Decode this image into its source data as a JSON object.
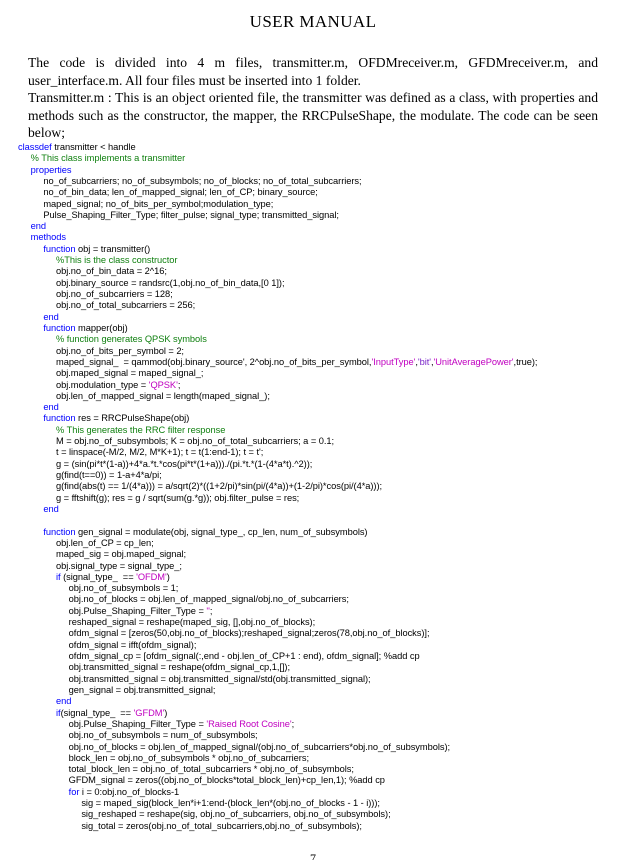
{
  "document": {
    "title": "USER MANUAL",
    "page_number": "7",
    "intro": {
      "paragraph_1": "The code is divided into 4 m files, transmitter.m, OFDMreceiver.m, GFDMreceiver.m, and user_interface.m. All four files must be inserted into 1 folder.",
      "paragraph_2": "Transmitter.m : This is an object oriented file, the transmitter was defined as a class, with properties and methods such as the constructor, the mapper, the RRCPulseShape, the modulate. The code can be seen below;"
    }
  },
  "colors": {
    "keyword": "#0000ff",
    "comment": "#108010",
    "string": "#c000c0",
    "string_alt": "#7a26c9",
    "text": "#000000",
    "background": "#ffffff"
  },
  "code_listing": {
    "language": "MATLAB",
    "lines": [
      {
        "indent": 0,
        "tokens": [
          {
            "t": "classdef ",
            "c": "kw"
          },
          {
            "t": "transmitter < handle",
            "c": "txt"
          }
        ]
      },
      {
        "indent": 1,
        "tokens": [
          {
            "t": "% This class implements a transmitter",
            "c": "cmt"
          }
        ]
      },
      {
        "indent": 1,
        "tokens": [
          {
            "t": "properties",
            "c": "kw"
          }
        ]
      },
      {
        "indent": 2,
        "tokens": [
          {
            "t": "no_of_subcarriers; no_of_subsymbols; no_of_blocks; no_of_total_subcarriers;",
            "c": "txt"
          }
        ]
      },
      {
        "indent": 2,
        "tokens": [
          {
            "t": "no_of_bin_data; len_of_mapped_signal; len_of_CP; binary_source;",
            "c": "txt"
          }
        ]
      },
      {
        "indent": 2,
        "tokens": [
          {
            "t": "maped_signal; no_of_bits_per_symbol;modulation_type;",
            "c": "txt"
          }
        ]
      },
      {
        "indent": 2,
        "tokens": [
          {
            "t": "Pulse_Shaping_Filter_Type; filter_pulse; signal_type; transmitted_signal;",
            "c": "txt"
          }
        ]
      },
      {
        "indent": 1,
        "tokens": [
          {
            "t": "end",
            "c": "kw"
          }
        ]
      },
      {
        "indent": 1,
        "tokens": [
          {
            "t": "methods",
            "c": "kw"
          }
        ]
      },
      {
        "indent": 2,
        "tokens": [
          {
            "t": "function ",
            "c": "kw"
          },
          {
            "t": "obj = transmitter()",
            "c": "txt"
          }
        ]
      },
      {
        "indent": 3,
        "tokens": [
          {
            "t": "%This is the class constructor",
            "c": "cmt"
          }
        ]
      },
      {
        "indent": 3,
        "tokens": [
          {
            "t": "obj.no_of_bin_data = 2^16;",
            "c": "txt"
          }
        ]
      },
      {
        "indent": 3,
        "tokens": [
          {
            "t": "obj.binary_source = randsrc(1,obj.no_of_bin_data,[0 1]);",
            "c": "txt"
          }
        ]
      },
      {
        "indent": 3,
        "tokens": [
          {
            "t": "obj.no_of_subcarriers = 128;",
            "c": "txt"
          }
        ]
      },
      {
        "indent": 3,
        "tokens": [
          {
            "t": "obj.no_of_total_subcarriers = 256;",
            "c": "txt"
          }
        ]
      },
      {
        "indent": 2,
        "tokens": [
          {
            "t": "end",
            "c": "kw"
          }
        ]
      },
      {
        "indent": 2,
        "tokens": [
          {
            "t": "function ",
            "c": "kw"
          },
          {
            "t": "mapper(obj)",
            "c": "txt"
          }
        ]
      },
      {
        "indent": 3,
        "tokens": [
          {
            "t": "% function generates QPSK symbols",
            "c": "cmt"
          }
        ]
      },
      {
        "indent": 3,
        "tokens": [
          {
            "t": "obj.no_of_bits_per_symbol = 2;",
            "c": "txt"
          }
        ]
      },
      {
        "indent": 3,
        "tokens": [
          {
            "t": "maped_signal_  = qammod(obj.binary_source', 2^obj.no_of_bits_per_symbol,",
            "c": "txt"
          },
          {
            "t": "'InputType'",
            "c": "str"
          },
          {
            "t": ",",
            "c": "txt"
          },
          {
            "t": "'bit'",
            "c": "str-b"
          },
          {
            "t": ",",
            "c": "txt"
          },
          {
            "t": "'UnitAveragePower'",
            "c": "str"
          },
          {
            "t": ",true);",
            "c": "txt"
          }
        ]
      },
      {
        "indent": 3,
        "tokens": [
          {
            "t": "obj.maped_signal = maped_signal_;",
            "c": "txt"
          }
        ]
      },
      {
        "indent": 3,
        "tokens": [
          {
            "t": "obj.modulation_type = ",
            "c": "txt"
          },
          {
            "t": "'QPSK'",
            "c": "str"
          },
          {
            "t": ";",
            "c": "txt"
          }
        ]
      },
      {
        "indent": 3,
        "tokens": [
          {
            "t": "obj.len_of_mapped_signal = length(maped_signal_);",
            "c": "txt"
          }
        ]
      },
      {
        "indent": 2,
        "tokens": [
          {
            "t": "end",
            "c": "kw"
          }
        ]
      },
      {
        "indent": 2,
        "tokens": [
          {
            "t": "function ",
            "c": "kw"
          },
          {
            "t": "res = RRCPulseShape(obj)",
            "c": "txt"
          }
        ]
      },
      {
        "indent": 3,
        "tokens": [
          {
            "t": "% This generates the RRC filter response",
            "c": "cmt"
          }
        ]
      },
      {
        "indent": 3,
        "tokens": [
          {
            "t": "M = obj.no_of_subsymbols; K = obj.no_of_total_subcarriers; a = 0.1;",
            "c": "txt"
          }
        ]
      },
      {
        "indent": 3,
        "tokens": [
          {
            "t": "t = linspace(-M/2, M/2, M*K+1); t = t(1:end-1); t = t';",
            "c": "txt"
          }
        ]
      },
      {
        "indent": 3,
        "tokens": [
          {
            "t": "g = (sin(pi*t*(1-a))+4*a.*t.*cos(pi*t*(1+a)))./(pi.*t.*(1-(4*a*t).^2));",
            "c": "txt"
          }
        ]
      },
      {
        "indent": 3,
        "tokens": [
          {
            "t": "g(find(t==0)) = 1-a+4*a/pi;",
            "c": "txt"
          }
        ]
      },
      {
        "indent": 3,
        "tokens": [
          {
            "t": "g(find(abs(t) == 1/(4*a))) = a/sqrt(2)*((1+2/pi)*sin(pi/(4*a))+(1-2/pi)*cos(pi/(4*a)));",
            "c": "txt"
          }
        ]
      },
      {
        "indent": 3,
        "tokens": [
          {
            "t": "g = fftshift(g); res = g / sqrt(sum(g.*g)); obj.filter_pulse = res;",
            "c": "txt"
          }
        ]
      },
      {
        "indent": 2,
        "tokens": [
          {
            "t": "end",
            "c": "kw"
          }
        ]
      },
      {
        "indent": 0,
        "tokens": []
      },
      {
        "indent": 2,
        "tokens": [
          {
            "t": "function ",
            "c": "kw"
          },
          {
            "t": "gen_signal = modulate(obj, signal_type_, cp_len, num_of_subsymbols)",
            "c": "txt"
          }
        ]
      },
      {
        "indent": 3,
        "tokens": [
          {
            "t": "obj.len_of_CP = cp_len;",
            "c": "txt"
          }
        ]
      },
      {
        "indent": 3,
        "tokens": [
          {
            "t": "maped_sig = obj.maped_signal;",
            "c": "txt"
          }
        ]
      },
      {
        "indent": 3,
        "tokens": [
          {
            "t": "obj.signal_type = signal_type_;",
            "c": "txt"
          }
        ]
      },
      {
        "indent": 3,
        "tokens": [
          {
            "t": "if ",
            "c": "kw"
          },
          {
            "t": "(signal_type_  == ",
            "c": "txt"
          },
          {
            "t": "'OFDM'",
            "c": "str"
          },
          {
            "t": ")",
            "c": "txt"
          }
        ]
      },
      {
        "indent": 4,
        "tokens": [
          {
            "t": "obj.no_of_subsymbols = 1;",
            "c": "txt"
          }
        ]
      },
      {
        "indent": 4,
        "tokens": [
          {
            "t": "obj.no_of_blocks = obj.len_of_mapped_signal/obj.no_of_subcarriers;",
            "c": "txt"
          }
        ]
      },
      {
        "indent": 4,
        "tokens": [
          {
            "t": "obj.Pulse_Shaping_Filter_Type = ",
            "c": "txt"
          },
          {
            "t": "''",
            "c": "str"
          },
          {
            "t": ";",
            "c": "txt"
          }
        ]
      },
      {
        "indent": 4,
        "tokens": [
          {
            "t": "reshaped_signal = reshape(maped_sig, [],obj.no_of_blocks);",
            "c": "txt"
          }
        ]
      },
      {
        "indent": 4,
        "tokens": [
          {
            "t": "ofdm_signal = [zeros(50,obj.no_of_blocks);reshaped_signal;zeros(78,obj.no_of_blocks)];",
            "c": "txt"
          }
        ]
      },
      {
        "indent": 4,
        "tokens": [
          {
            "t": "ofdm_signal = ifft(ofdm_signal);",
            "c": "txt"
          }
        ]
      },
      {
        "indent": 4,
        "tokens": [
          {
            "t": "ofdm_signal_cp = [ofdm_signal(:,end - obj.len_of_CP+1 : end), ofdm_signal]; %add cp",
            "c": "txt"
          }
        ]
      },
      {
        "indent": 4,
        "tokens": [
          {
            "t": "obj.transmitted_signal = reshape(ofdm_signal_cp,1,[]);",
            "c": "txt"
          }
        ]
      },
      {
        "indent": 4,
        "tokens": [
          {
            "t": "obj.transmitted_signal = obj.transmitted_signal/std(obj.transmitted_signal);",
            "c": "txt"
          }
        ]
      },
      {
        "indent": 4,
        "tokens": [
          {
            "t": "gen_signal = obj.transmitted_signal;",
            "c": "txt"
          }
        ]
      },
      {
        "indent": 3,
        "tokens": [
          {
            "t": "end",
            "c": "kw"
          }
        ]
      },
      {
        "indent": 3,
        "tokens": [
          {
            "t": "if",
            "c": "kw"
          },
          {
            "t": "(signal_type_  == ",
            "c": "txt"
          },
          {
            "t": "'GFDM'",
            "c": "str"
          },
          {
            "t": ")",
            "c": "txt"
          }
        ]
      },
      {
        "indent": 4,
        "tokens": [
          {
            "t": "obj.Pulse_Shaping_Filter_Type = ",
            "c": "txt"
          },
          {
            "t": "'Raised Root Cosine'",
            "c": "str"
          },
          {
            "t": ";",
            "c": "txt"
          }
        ]
      },
      {
        "indent": 4,
        "tokens": [
          {
            "t": "obj.no_of_subsymbols = num_of_subsymbols;",
            "c": "txt"
          }
        ]
      },
      {
        "indent": 4,
        "tokens": [
          {
            "t": "obj.no_of_blocks = obj.len_of_mapped_signal/(obj.no_of_subcarriers*obj.no_of_subsymbols);",
            "c": "txt"
          }
        ]
      },
      {
        "indent": 4,
        "tokens": [
          {
            "t": "block_len = obj.no_of_subsymbols * obj.no_of_subcarriers;",
            "c": "txt"
          }
        ]
      },
      {
        "indent": 4,
        "tokens": [
          {
            "t": "total_block_len = obj.no_of_total_subcarriers * obj.no_of_subsymbols;",
            "c": "txt"
          }
        ]
      },
      {
        "indent": 4,
        "tokens": [
          {
            "t": "GFDM_signal = zeros((obj.no_of_blocks*total_block_len)+cp_len,1); %add cp",
            "c": "txt"
          }
        ]
      },
      {
        "indent": 4,
        "tokens": [
          {
            "t": "for ",
            "c": "kw"
          },
          {
            "t": "i = 0:obj.no_of_blocks-1",
            "c": "txt"
          }
        ]
      },
      {
        "indent": 5,
        "tokens": [
          {
            "t": "sig = maped_sig(block_len*i+1:end-(block_len*(obj.no_of_blocks - 1 - i)));",
            "c": "txt"
          }
        ]
      },
      {
        "indent": 5,
        "tokens": [
          {
            "t": "sig_reshaped = reshape(sig, obj.no_of_subcarriers, obj.no_of_subsymbols);",
            "c": "txt"
          }
        ]
      },
      {
        "indent": 5,
        "tokens": [
          {
            "t": "sig_total = zeros(obj.no_of_total_subcarriers,obj.no_of_subsymbols);",
            "c": "txt"
          }
        ]
      }
    ]
  }
}
